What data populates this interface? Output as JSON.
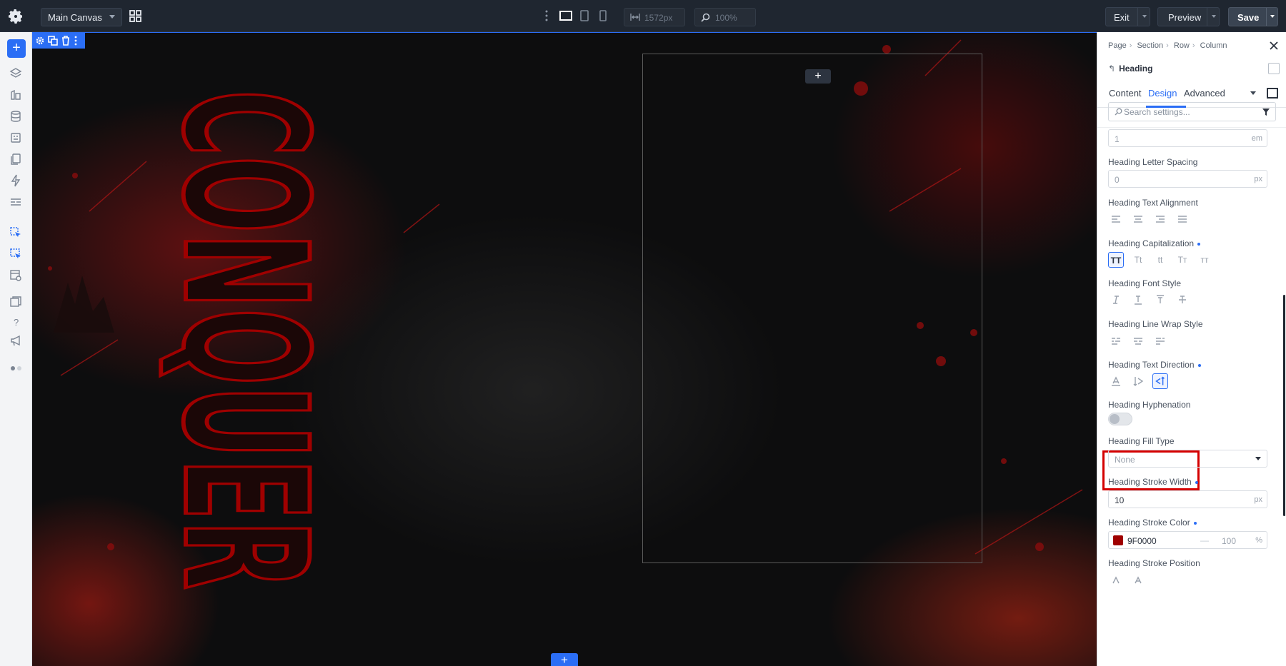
{
  "topbar": {
    "canvas_name": "Main Canvas",
    "width_value": "1572px",
    "zoom_value": "100%",
    "exit_label": "Exit",
    "preview_label": "Preview",
    "save_label": "Save"
  },
  "canvas": {
    "heading_text": "CONQUER",
    "add_column_glyph": "+",
    "add_section_glyph": "+"
  },
  "panel": {
    "breadcrumb": [
      "Page",
      "Section",
      "Row",
      "Column"
    ],
    "element_title": "Heading",
    "tabs": [
      "Content",
      "Design",
      "Advanced"
    ],
    "active_tab": "Design",
    "search_placeholder": "Search settings...",
    "line_height_value": "1",
    "line_height_unit": "em",
    "letter_spacing": {
      "label": "Heading Letter Spacing",
      "value": "0",
      "unit": "px"
    },
    "text_alignment": {
      "label": "Heading Text Alignment"
    },
    "capitalization": {
      "label": "Heading Capitalization",
      "options": [
        "TT",
        "Tt",
        "tt",
        "Tт",
        "ᴛᴛ"
      ]
    },
    "font_style": {
      "label": "Heading Font Style"
    },
    "line_wrap": {
      "label": "Heading Line Wrap Style"
    },
    "text_direction": {
      "label": "Heading Text Direction"
    },
    "hyphenation": {
      "label": "Heading Hyphenation"
    },
    "fill_type": {
      "label": "Heading Fill Type",
      "value": "None"
    },
    "stroke_width": {
      "label": "Heading Stroke Width",
      "value": "10",
      "unit": "px"
    },
    "stroke_color": {
      "label": "Heading Stroke Color",
      "value": "9F0000",
      "opacity": "100",
      "unit": "%",
      "swatch": "#9F0000"
    },
    "stroke_position": {
      "label": "Heading Stroke Position"
    }
  },
  "colors": {
    "accent": "#2B6EF5",
    "highlight": "#D40000",
    "stroke": "#9F0000"
  }
}
